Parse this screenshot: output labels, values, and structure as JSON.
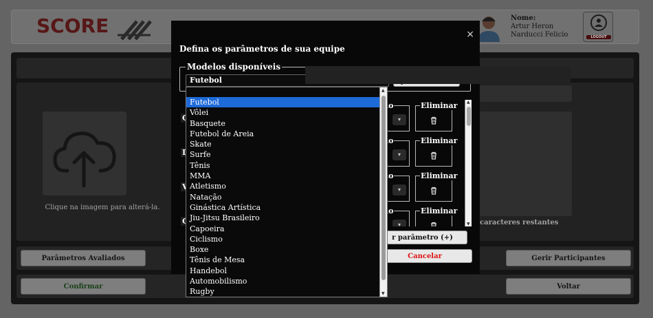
{
  "header": {
    "logo_text": "SCORE",
    "user_label": "Nome:",
    "user_name": "Artur Heron Narducci Felicio",
    "logout_label": "LOGOUT"
  },
  "page": {
    "upload_caption": "Clique na imagem para alterá-la.",
    "char_counter": "caracteres restantes",
    "evaluated_params_button": "Parâmetros Avaliados",
    "manage_participants_button": "Gerir Participantes",
    "confirm_button": "Confirmar",
    "back_button": "Voltar",
    "side_letters": [
      "C",
      "D",
      "V",
      "C"
    ]
  },
  "modal": {
    "close_icon": "×",
    "title": "Defina os parâmetros de sua equipe",
    "models_legend": "Modelos disponíveis",
    "selected_model": "Futebol",
    "apply_button": "Aplicar modelo",
    "column_stub_label": "io",
    "eliminate_label": "Eliminar",
    "add_param_button": "r parâmetro (+)",
    "cancel_button": "Cancelar"
  },
  "dropdown": {
    "selected": "Futebol",
    "options": [
      "Futebol",
      "Vôlei",
      "Basquete",
      "Futebol de Areia",
      "Skate",
      "Surfe",
      "Tênis",
      "MMA",
      "Atletismo",
      "Natação",
      "Ginástica Artística",
      "Jiu-Jitsu Brasileiro",
      "Capoeira",
      "Ciclismo",
      "Boxe",
      "Tênis de Mesa",
      "Handebol",
      "Automobilismo",
      "Rugby"
    ]
  },
  "colors": {
    "accent_selected": "#1e6ad8",
    "cancel_text": "#dd1111",
    "confirm_text": "#1f4f1f",
    "logo": "#6b1d1d"
  }
}
